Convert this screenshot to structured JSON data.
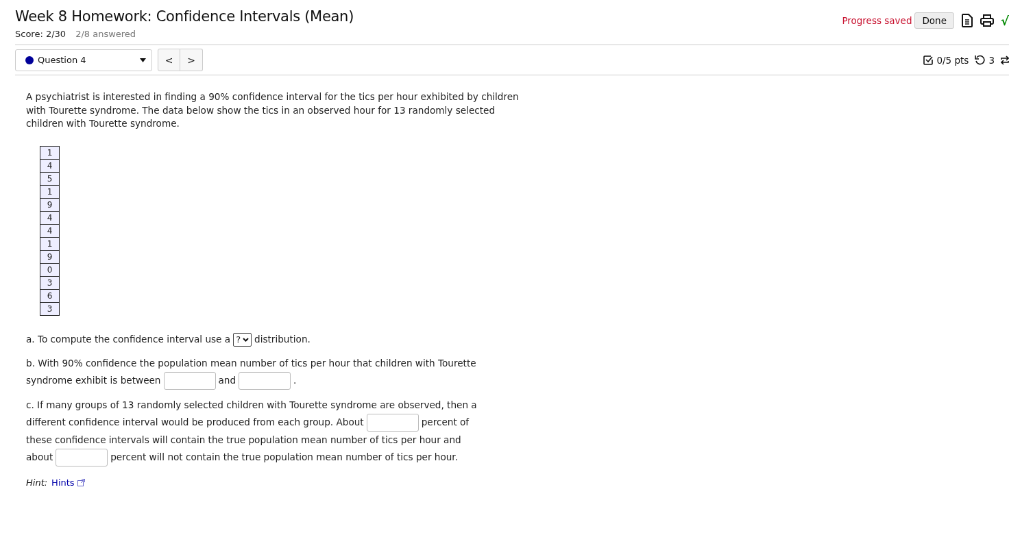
{
  "header": {
    "title": "Week 8 Homework: Confidence Intervals (Mean)",
    "score": "Score: 2/30",
    "answered": "2/8 answered",
    "status": "Progress saved",
    "done_button": "Done",
    "math_symbol": "√"
  },
  "question_bar": {
    "selector": "Question 4",
    "prev": "<",
    "next": ">",
    "points": "0/5 pts",
    "attempts": "3"
  },
  "intro": "A psychiatrist is interested in finding a 90% confidence interval for the tics per hour exhibited by children with Tourette syndrome. The data below show the tics in an observed hour for 13 randomly selected children with Tourette syndrome.",
  "data_values": [
    "1",
    "4",
    "5",
    "1",
    "9",
    "4",
    "4",
    "1",
    "9",
    "0",
    "3",
    "6",
    "3"
  ],
  "parts": [
    [
      {
        "kind": "text",
        "text": "a. To compute the confidence interval use a"
      },
      {
        "kind": "select",
        "value": "?"
      },
      {
        "kind": "text",
        "text": "distribution."
      }
    ],
    [
      {
        "kind": "text",
        "text": "b. With 90% confidence the population mean number of tics per hour that children with Tourette"
      },
      {
        "kind": "break"
      },
      {
        "kind": "text",
        "text": "syndrome exhibit is between"
      },
      {
        "kind": "blank"
      },
      {
        "kind": "text",
        "text": "and"
      },
      {
        "kind": "blank"
      },
      {
        "kind": "text",
        "text": "."
      }
    ],
    [
      {
        "kind": "text",
        "text": "c. If many groups of 13 randomly selected  children with Tourette syndrome are observed, then a"
      },
      {
        "kind": "break"
      },
      {
        "kind": "text",
        "text": "different confidence interval would be produced from each group. About"
      },
      {
        "kind": "blank"
      },
      {
        "kind": "text",
        "text": "percent of"
      },
      {
        "kind": "break"
      },
      {
        "kind": "text",
        "text": "these confidence intervals will contain the true population mean number of tics per hour and"
      },
      {
        "kind": "break"
      },
      {
        "kind": "text",
        "text": "about"
      },
      {
        "kind": "blank"
      },
      {
        "kind": "text",
        "text": "percent will not contain the true population mean number of tics per hour."
      }
    ]
  ],
  "hint": {
    "label": "Hint:",
    "link": "Hints"
  }
}
